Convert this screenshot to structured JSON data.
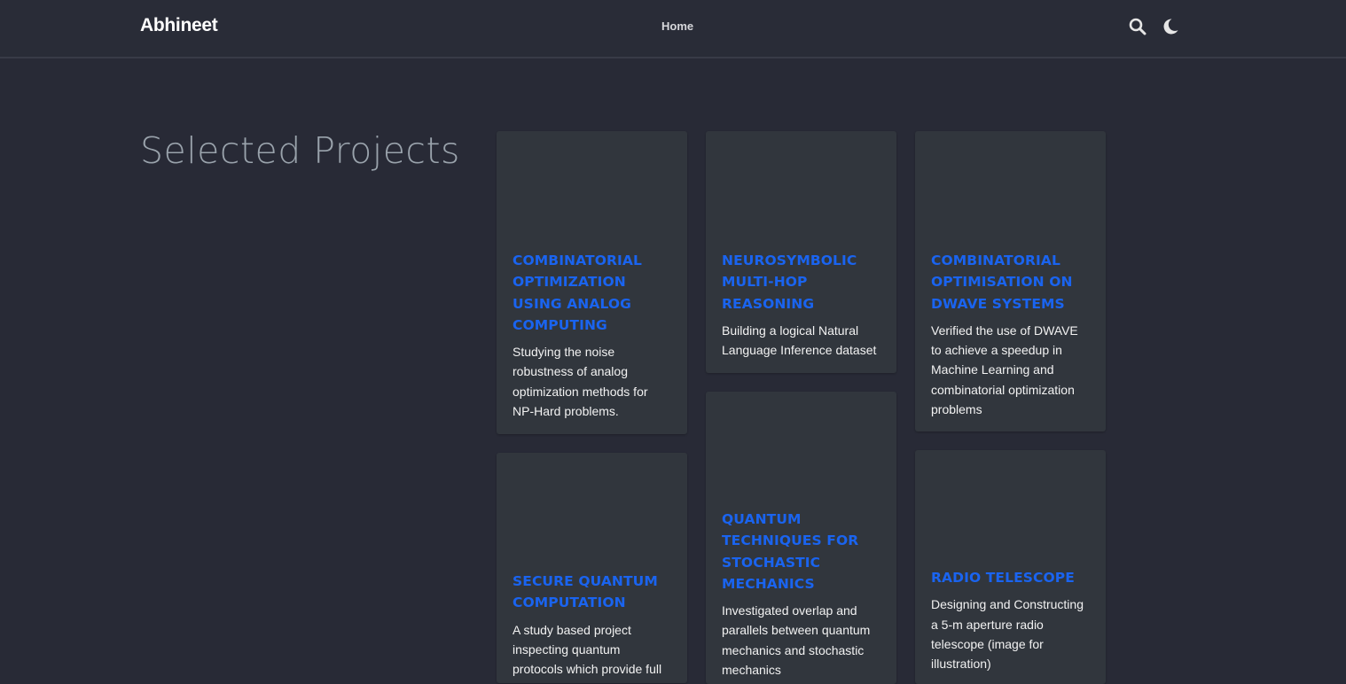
{
  "navbar": {
    "brand": "Abhineet",
    "home_label": "Home"
  },
  "icons": {
    "search": "search-icon",
    "theme": "moon-icon"
  },
  "colors": {
    "background": "#282a36",
    "card": "#31363d",
    "accent": "#1a64f0",
    "title_gray": "#9aa3ac"
  },
  "main": {
    "section_title": "Selected Projects",
    "projects": [
      {
        "title": "Combinatorial Optimization using Analog Computing",
        "description": "Studying the noise robustness of analog optimization methods for NP-Hard problems."
      },
      {
        "title": "Neurosymbolic Multi-Hop Reasoning",
        "description": "Building a logical Natural Language Inference dataset"
      },
      {
        "title": "Combinatorial Optimisation on DWAVE Systems",
        "description": "Verified the use of DWAVE to achieve a speedup in Machine Learning and combinatorial optimization problems"
      },
      {
        "title": "Secure Quantum Computation",
        "description": "A study based project inspecting quantum protocols which provide full"
      },
      {
        "title": "Quantum Techniques for Stochastic Mechanics",
        "description": "Investigated overlap and parallels between quantum mechanics and stochastic mechanics"
      },
      {
        "title": "Radio Telescope",
        "description": "Designing and Constructing a 5-m aperture radio telescope (image for illustration)"
      }
    ]
  }
}
